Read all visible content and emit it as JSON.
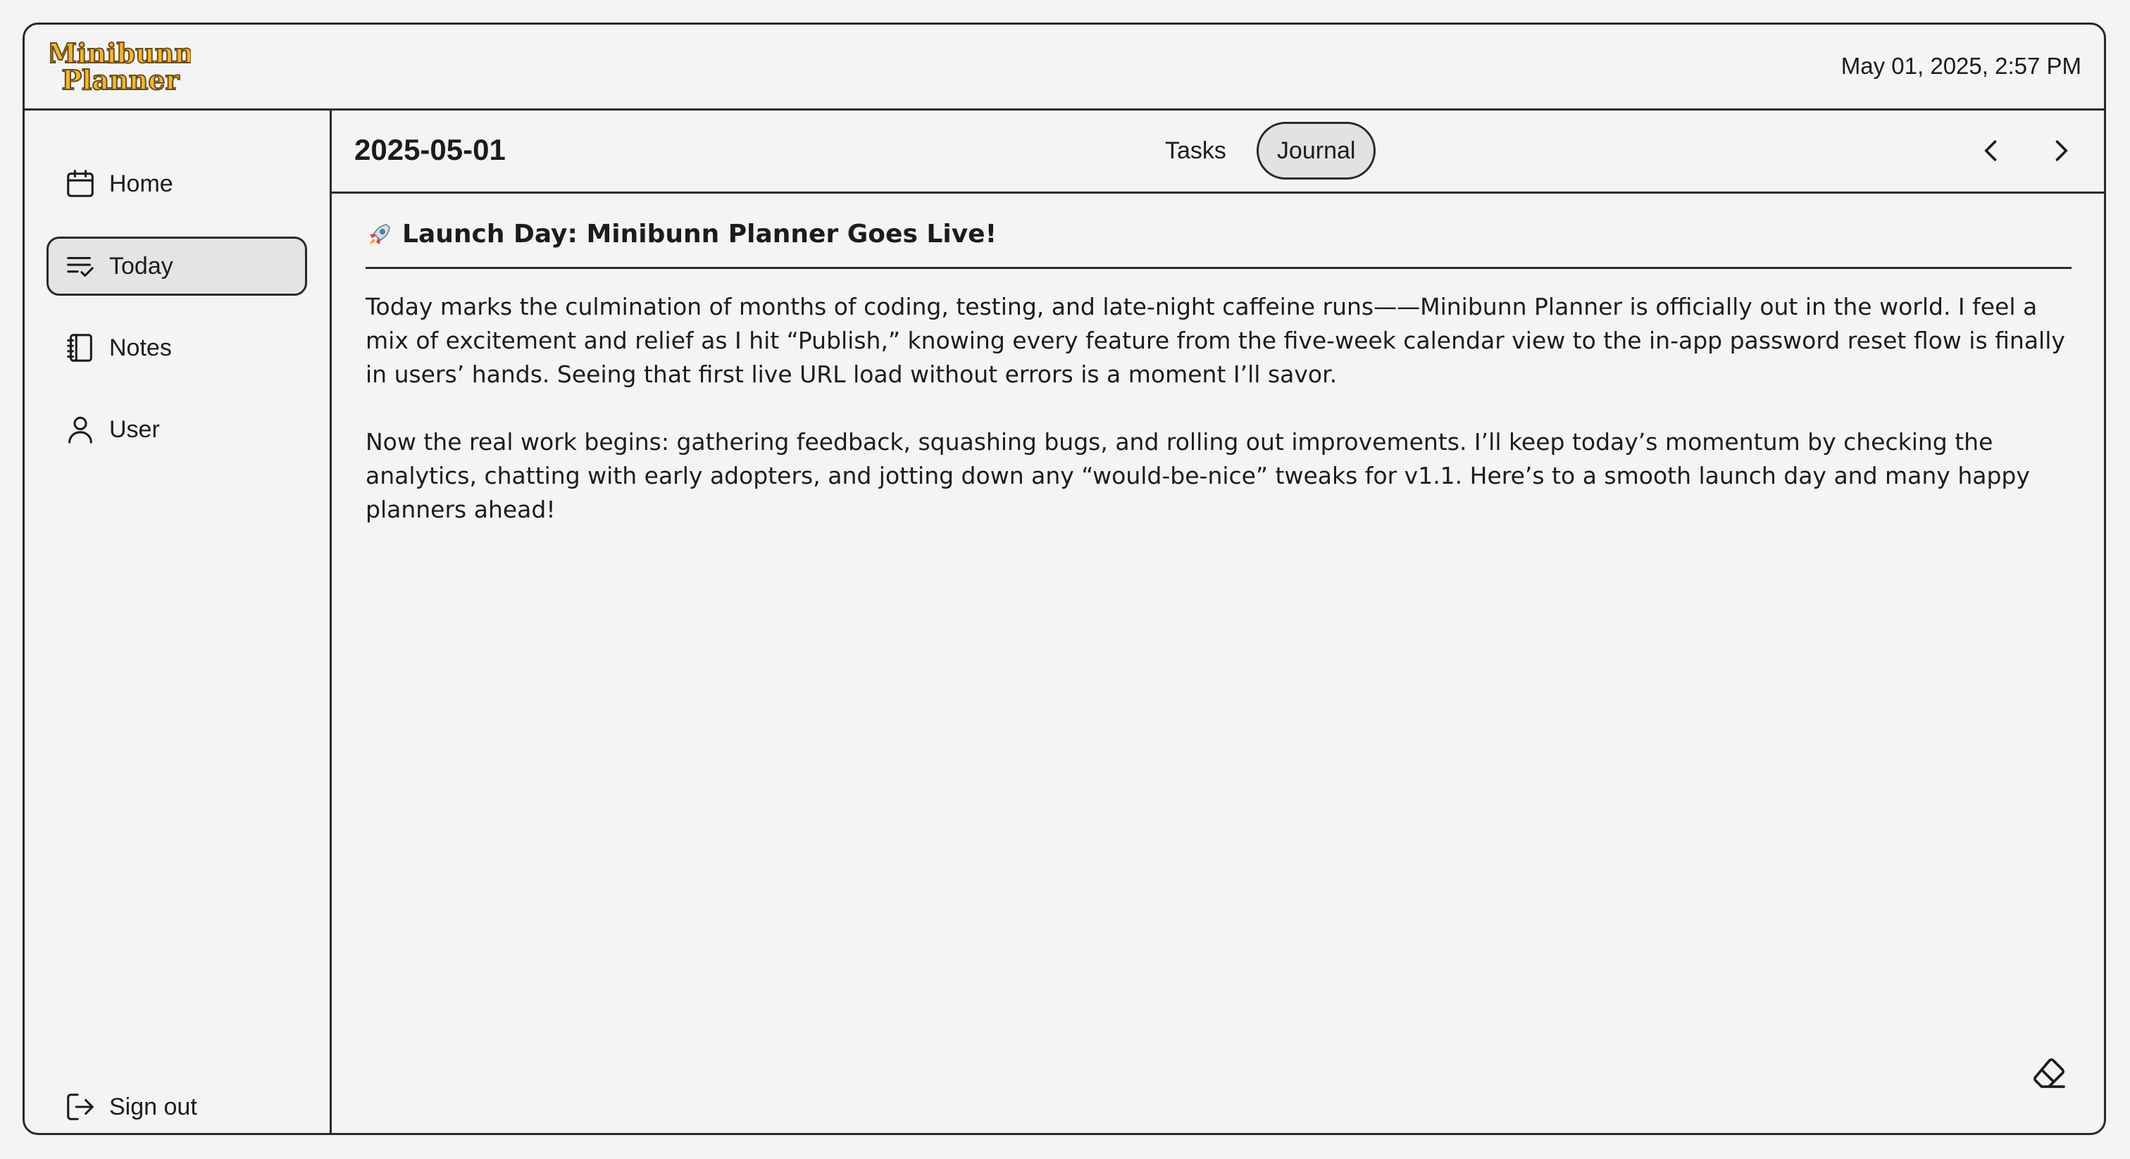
{
  "app": {
    "logo_text_line1": "Minibunn",
    "logo_text_line2": "Planner",
    "datetime": "May 01, 2025, 2:57 PM",
    "colors": {
      "logo_fill": "#f2b634",
      "logo_stroke": "#6b4a16",
      "border": "#2a2a2a",
      "background": "#f4f4f4"
    }
  },
  "sidebar": {
    "items": [
      {
        "label": "Home",
        "icon": "calendar-icon",
        "active": false
      },
      {
        "label": "Today",
        "icon": "checklist-icon",
        "active": true
      },
      {
        "label": "Notes",
        "icon": "notebook-icon",
        "active": false
      },
      {
        "label": "User",
        "icon": "user-icon",
        "active": false
      }
    ],
    "signout": {
      "label": "Sign out",
      "icon": "sign-out-icon"
    }
  },
  "main": {
    "date": "2025-05-01",
    "tabs": [
      {
        "label": "Tasks",
        "active": false
      },
      {
        "label": "Journal",
        "active": true
      }
    ],
    "prev_icon": "chevron-left-icon",
    "next_icon": "chevron-right-icon",
    "clear_icon": "eraser-icon"
  },
  "journal": {
    "emoji": "rocket-icon",
    "title": "Launch Day: Minibunn Planner Goes Live!",
    "paragraphs": [
      "Today marks the culmination of months of coding, testing, and late-night caffeine runs——Minibunn Planner is officially out in the world. I feel a mix of excitement and relief as I hit “Publish,” knowing every feature from the five-week calendar view to the in-app password reset flow is finally in users’ hands. Seeing that first live URL load without errors is a moment I’ll savor.",
      "Now the real work begins: gathering feedback, squashing bugs, and rolling out improvements. I’ll keep today’s momentum by checking the analytics, chatting with early adopters, and jotting down any “would-be-nice” tweaks for v1.1. Here’s to a smooth launch day and many happy planners ahead!"
    ]
  }
}
